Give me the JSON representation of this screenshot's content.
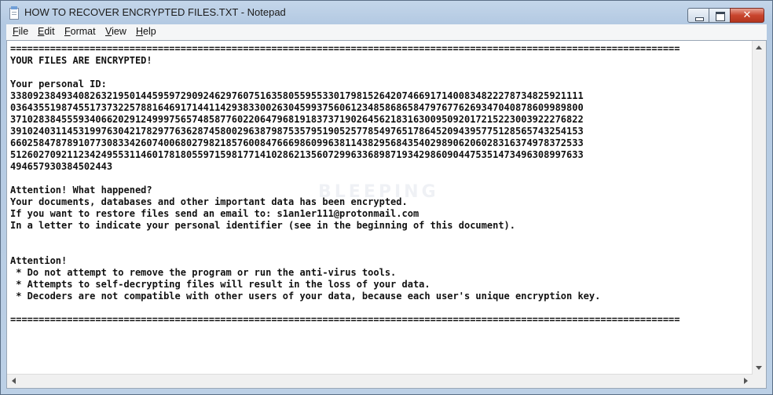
{
  "window": {
    "title": "HOW TO RECOVER ENCRYPTED FILES.TXT - Notepad",
    "close_glyph": "✕"
  },
  "menu": [
    {
      "accel": "F",
      "rest": "ile"
    },
    {
      "accel": "E",
      "rest": "dit"
    },
    {
      "accel": "F",
      "rest": "ormat"
    },
    {
      "accel": "V",
      "rest": "iew"
    },
    {
      "accel": "H",
      "rest": "elp"
    }
  ],
  "watermark": "BLEEPING",
  "document": {
    "lines": [
      "======================================================================================================================",
      "YOUR FILES ARE ENCRYPTED!",
      "",
      "Your personal ID:",
      "33809238493408263219501445959729092462976075163580559553301798152642074669171400834822278734825921111",
      "03643551987455173732257881646917144114293833002630459937560612348586865847976776269347040878609989800",
      "37102838455593406620291249997565748587760220647968191837371902645621831630095092017215223003922276822",
      "39102403114531997630421782977636287458002963879875357951905257785497651786452094395775128565743254153",
      "66025847878910773083342607400680279821857600847666986099638114382956843540298906206028316374978372533",
      "51260270921123424955311460178180559715981771410286213560729963368987193429860904475351473496308997633",
      "494657930384502443",
      "",
      "Attention! What happened?",
      "Your documents, databases and other important data has been encrypted.",
      "If you want to restore files send an email to: s1an1er111@protonmail.com",
      "In a letter to indicate your personal identifier (see in the beginning of this document).",
      "",
      "",
      "Attention!",
      " * Do not attempt to remove the program or run the anti-virus tools.",
      " * Attempts to self-decrypting files will result in the loss of your data.",
      " * Decoders are not compatible with other users of your data, because each user's unique encryption key.",
      "",
      "======================================================================================================================"
    ]
  }
}
